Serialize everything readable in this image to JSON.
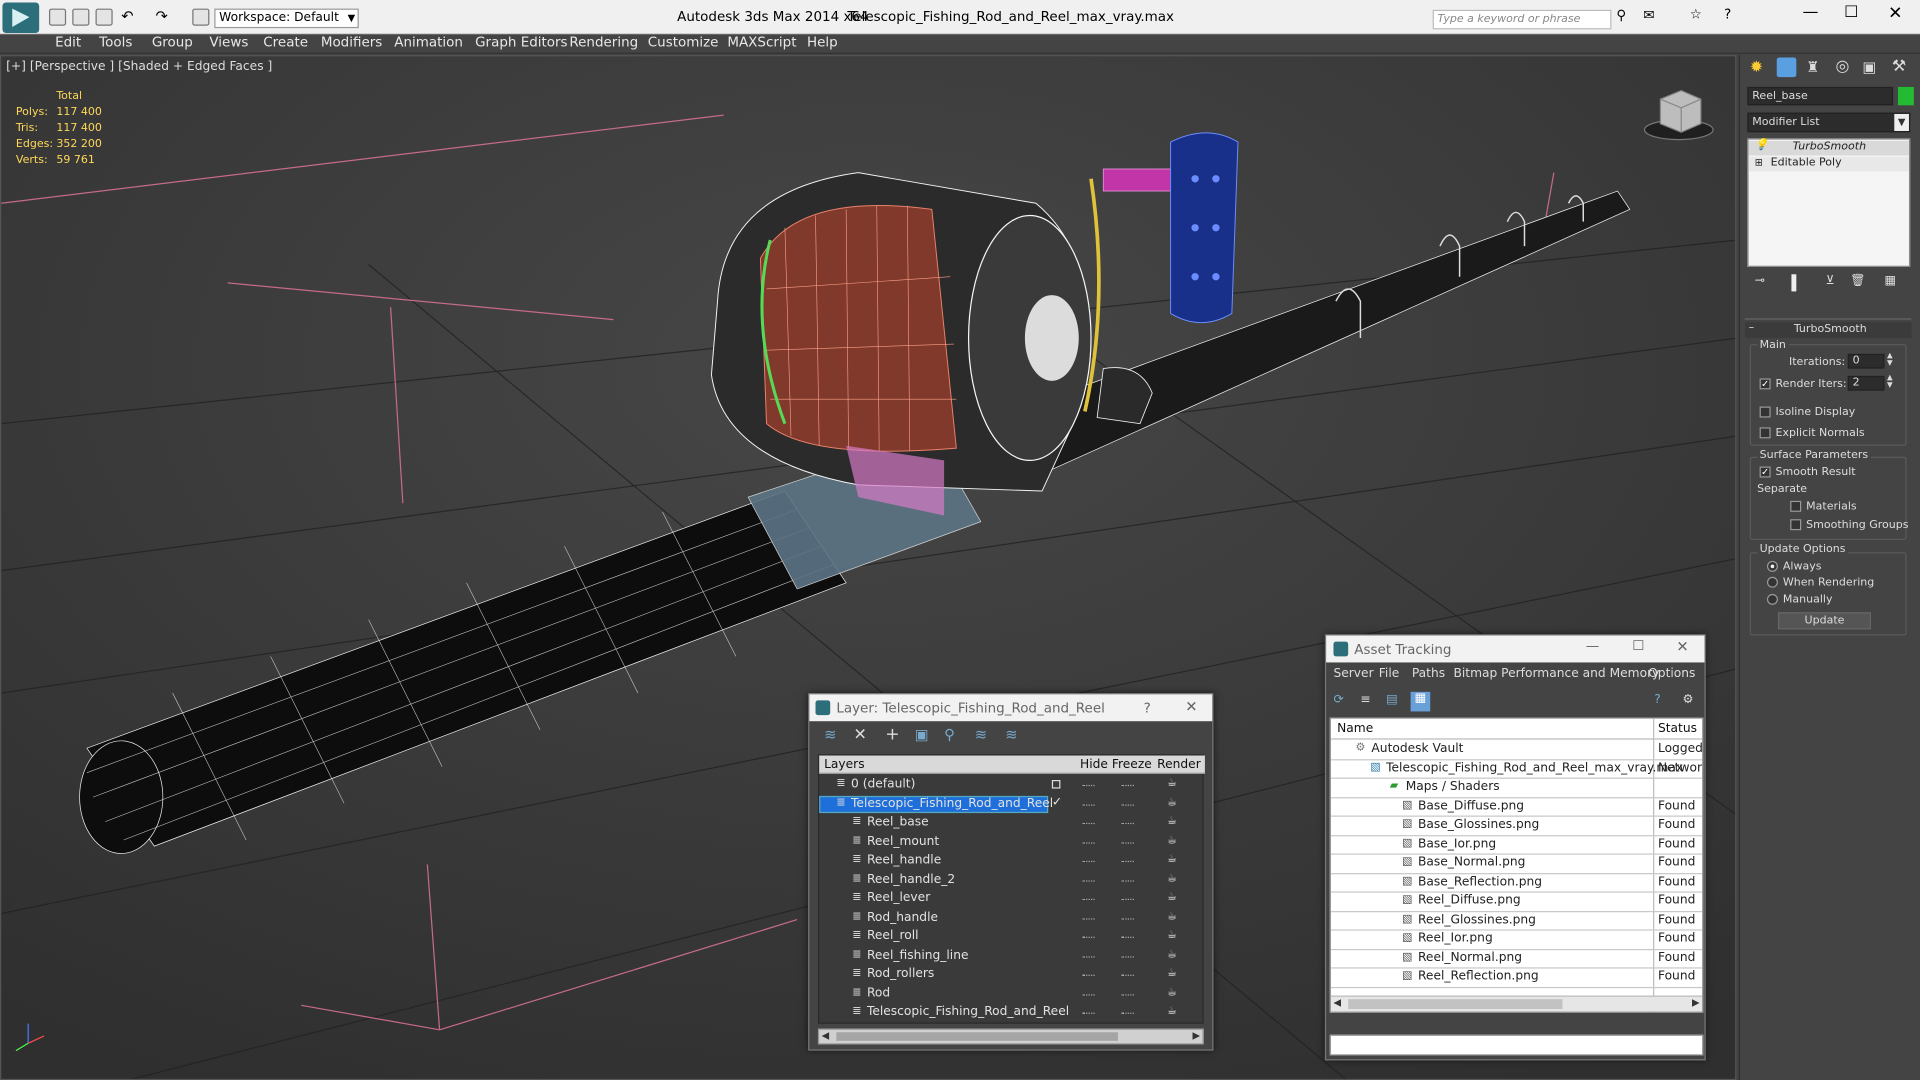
{
  "app": {
    "title": "Autodesk 3ds Max  2014 x64",
    "file": "Telescopic_Fishing_Rod_and_Reel_max_vray.max",
    "workspace": "Workspace: Default",
    "search_placeholder": "Type a keyword or phrase"
  },
  "menu": [
    "Edit",
    "Tools",
    "Group",
    "Views",
    "Create",
    "Modifiers",
    "Animation",
    "Graph Editors",
    "Rendering",
    "Customize",
    "MAXScript",
    "Help"
  ],
  "viewport": {
    "label": "[+] [Perspective ] [Shaded + Edged Faces ]",
    "stats": {
      "header": "Total",
      "rows": [
        {
          "label": "Polys:",
          "value": "117 400"
        },
        {
          "label": "Tris:",
          "value": "117 400"
        },
        {
          "label": "Edges:",
          "value": "352 200"
        },
        {
          "label": "Verts:",
          "value": "59 761"
        }
      ]
    }
  },
  "command_panel": {
    "object_name": "Reel_base",
    "object_color": "#22bb33",
    "modifier_list": "Modifier List",
    "stack": [
      "TurboSmooth",
      "Editable Poly"
    ],
    "rollout_title": "TurboSmooth",
    "main_label": "Main",
    "iterations_label": "Iterations:",
    "iterations_value": "0",
    "render_iters_label": "Render Iters:",
    "render_iters_value": "2",
    "render_iters_checked": true,
    "isoline_label": "Isoline Display",
    "explicit_normals_label": "Explicit Normals",
    "surface_label": "Surface Parameters",
    "smooth_result_label": "Smooth Result",
    "separate_label": "Separate",
    "materials_label": "Materials",
    "smoothing_groups_label": "Smoothing Groups",
    "update_options_label": "Update Options",
    "always_label": "Always",
    "when_rendering_label": "When Rendering",
    "manually_label": "Manually",
    "update_button": "Update"
  },
  "layer_dialog": {
    "title": "Layer: Telescopic_Fishing_Rod_and_Reel",
    "help": "?",
    "columns": {
      "layers": "Layers",
      "hide": "Hide",
      "freeze": "Freeze",
      "render": "Render"
    },
    "rows": [
      {
        "name": "0 (default)",
        "indent": 1,
        "selected": false
      },
      {
        "name": "Telescopic_Fishing_Rod_and_Reel",
        "indent": 1,
        "selected": true
      },
      {
        "name": "Reel_base",
        "indent": 2,
        "selected": false
      },
      {
        "name": "Reel_mount",
        "indent": 2,
        "selected": false
      },
      {
        "name": "Reel_handle",
        "indent": 2,
        "selected": false
      },
      {
        "name": "Reel_handle_2",
        "indent": 2,
        "selected": false
      },
      {
        "name": "Reel_lever",
        "indent": 2,
        "selected": false
      },
      {
        "name": "Rod_handle",
        "indent": 2,
        "selected": false
      },
      {
        "name": "Reel_roll",
        "indent": 2,
        "selected": false
      },
      {
        "name": "Reel_fishing_line",
        "indent": 2,
        "selected": false
      },
      {
        "name": "Rod_rollers",
        "indent": 2,
        "selected": false
      },
      {
        "name": "Rod",
        "indent": 2,
        "selected": false
      },
      {
        "name": "Telescopic_Fishing_Rod_and_Reel",
        "indent": 2,
        "selected": false
      }
    ]
  },
  "asset_tracking": {
    "title": "Asset Tracking",
    "menu": [
      "Server",
      "File",
      "Paths",
      "Bitmap Performance and Memory",
      "Options"
    ],
    "columns": {
      "name": "Name",
      "status": "Status"
    },
    "rows": [
      {
        "name": "Autodesk Vault",
        "status": "Logged",
        "indent": 1
      },
      {
        "name": "Telescopic_Fishing_Rod_and_Reel_max_vray.max",
        "status": "Network",
        "indent": 2
      },
      {
        "name": "Maps / Shaders",
        "status": "",
        "indent": 3
      },
      {
        "name": "Base_Diffuse.png",
        "status": "Found",
        "indent": 4
      },
      {
        "name": "Base_Glossines.png",
        "status": "Found",
        "indent": 4
      },
      {
        "name": "Base_Ior.png",
        "status": "Found",
        "indent": 4
      },
      {
        "name": "Base_Normal.png",
        "status": "Found",
        "indent": 4
      },
      {
        "name": "Base_Reflection.png",
        "status": "Found",
        "indent": 4
      },
      {
        "name": "Reel_Diffuse.png",
        "status": "Found",
        "indent": 4
      },
      {
        "name": "Reel_Glossines.png",
        "status": "Found",
        "indent": 4
      },
      {
        "name": "Reel_Ior.png",
        "status": "Found",
        "indent": 4
      },
      {
        "name": "Reel_Normal.png",
        "status": "Found",
        "indent": 4
      },
      {
        "name": "Reel_Reflection.png",
        "status": "Found",
        "indent": 4
      }
    ]
  }
}
